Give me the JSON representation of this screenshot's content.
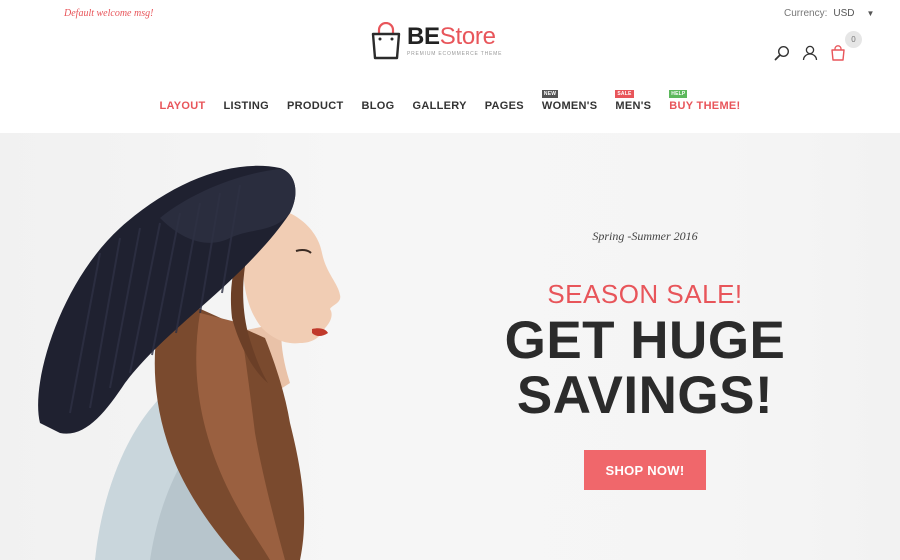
{
  "topbar": {
    "welcome": "Default welcome msg!",
    "currency_label": "Currency:",
    "currency_value": "USD"
  },
  "logo": {
    "be": "BE",
    "store": "Store",
    "tagline": "PREMIUM ECOMMERCE THEME"
  },
  "header": {
    "cart_count": "0",
    "icons": [
      "search-icon",
      "user-icon",
      "cart-icon"
    ]
  },
  "nav": {
    "items": [
      {
        "label": "LAYOUT",
        "active": true
      },
      {
        "label": "LISTING"
      },
      {
        "label": "PRODUCT"
      },
      {
        "label": "BLOG"
      },
      {
        "label": "GALLERY"
      },
      {
        "label": "PAGES"
      },
      {
        "label": "WOMEN'S",
        "badge": "NEW"
      },
      {
        "label": "MEN'S",
        "badge": "SALE"
      },
      {
        "label": "BUY THEME!",
        "badge": "HELP"
      }
    ]
  },
  "hero": {
    "subtitle": "Spring -Summer 2016",
    "kicker": "SEASON SALE!",
    "title_line1": "GET HUGE",
    "title_line2": "SAVINGS!",
    "cta": "SHOP NOW!"
  },
  "colors": {
    "accent": "#e8555a",
    "button": "#f0676b",
    "badge_new": "#555555",
    "badge_sale": "#e8555a",
    "badge_help": "#5cb85c"
  }
}
